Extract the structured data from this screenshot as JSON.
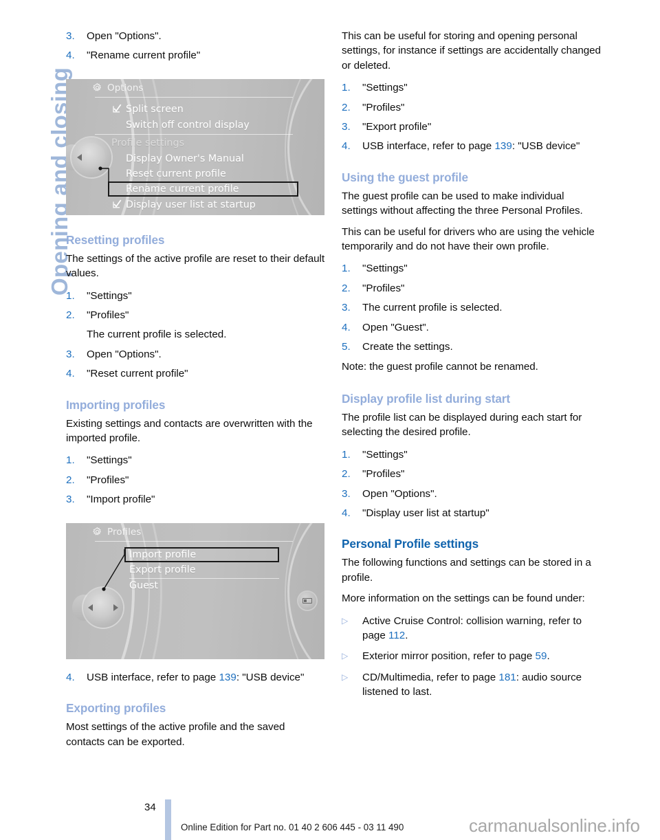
{
  "chapter": {
    "tab_label": "Opening and closing"
  },
  "footer": {
    "page_number": "34",
    "edition_text": "Online Edition for Part no. 01 40 2 606 445 - 03 11 490",
    "watermark": "carmanualsonline.info"
  },
  "colors": {
    "heading_sub": "#93addb",
    "heading_main": "#0f63ad",
    "list_number": "#1d6fbe",
    "page_ref": "#1d6fbe",
    "chapter_tab": "#9fb7da",
    "footer_bar": "#b4c6e2"
  },
  "left_column": {
    "top_steps": [
      {
        "num": "3.",
        "text": "Open \"Options\"."
      },
      {
        "num": "4.",
        "text": "\"Rename current profile\""
      }
    ],
    "figure_options": {
      "name": "idrive-options-screen",
      "header_title": "Options",
      "header_icon": "gear-icon",
      "rows": [
        {
          "label": "Split screen",
          "checkbox": true,
          "dim": false,
          "selected": false
        },
        {
          "label": "Switch off control display",
          "checkbox": false,
          "dim": false,
          "selected": false
        },
        {
          "label": "Profile settings",
          "checkbox": false,
          "dim": true,
          "selected": false
        },
        {
          "label": "Display Owner's Manual",
          "checkbox": false,
          "dim": false,
          "selected": false
        },
        {
          "label": "Reset current profile",
          "checkbox": false,
          "dim": false,
          "selected": false
        },
        {
          "label": "Rename current profile",
          "checkbox": false,
          "dim": false,
          "selected": true
        },
        {
          "label": "Display user list at startup",
          "checkbox": true,
          "dim": false,
          "selected": false
        }
      ]
    },
    "resetting": {
      "heading": "Resetting profiles",
      "intro": "The settings of the active profile are reset to their default values.",
      "steps": [
        {
          "num": "1.",
          "text": "\"Settings\""
        },
        {
          "num": "2.",
          "text": "\"Profiles\""
        },
        {
          "num": "3.",
          "text": "Open \"Options\"."
        },
        {
          "num": "4.",
          "text": "\"Reset current profile\""
        }
      ],
      "substep_note": "The current profile is selected."
    },
    "importing": {
      "heading": "Importing profiles",
      "intro": "Existing settings and contacts are overwritten with the imported profile.",
      "steps": [
        {
          "num": "1.",
          "text": "\"Settings\""
        },
        {
          "num": "2.",
          "text": "\"Profiles\""
        },
        {
          "num": "3.",
          "text": "\"Import profile\""
        }
      ],
      "usb_step": {
        "num": "4.",
        "prefix": "USB interface, refer to page ",
        "page": "139",
        "suffix": ": \"USB device\""
      }
    },
    "figure_profiles": {
      "name": "idrive-profiles-screen",
      "header_title": "Profiles",
      "header_icon": "gear-icon",
      "rows": [
        {
          "label": "Import profile",
          "selected": true
        },
        {
          "label": "Export profile",
          "selected": false
        },
        {
          "label": "Guest",
          "selected": false
        }
      ]
    },
    "exporting": {
      "heading": "Exporting profiles",
      "intro": "Most settings of the active profile and the saved contacts can be exported."
    }
  },
  "right_column": {
    "export_intro": "This can be useful for storing and opening personal settings, for instance if settings are accidentally changed or deleted.",
    "export_steps": [
      {
        "num": "1.",
        "text": "\"Settings\""
      },
      {
        "num": "2.",
        "text": "\"Profiles\""
      },
      {
        "num": "3.",
        "text": "\"Export profile\""
      }
    ],
    "export_usb_step": {
      "num": "4.",
      "prefix": "USB interface, refer to page ",
      "page": "139",
      "suffix": ": \"USB device\""
    },
    "guest": {
      "heading": "Using the guest profile",
      "para1": "The guest profile can be used to make individual settings without affecting the three Personal Profiles.",
      "para2": "This can be useful for drivers who are using the vehicle temporarily and do not have their own profile.",
      "steps": [
        {
          "num": "1.",
          "text": "\"Settings\""
        },
        {
          "num": "2.",
          "text": "\"Profiles\""
        },
        {
          "num": "3.",
          "text": "The current profile is selected."
        },
        {
          "num": "4.",
          "text": "Open \"Guest\"."
        },
        {
          "num": "5.",
          "text": "Create the settings."
        }
      ],
      "note": "Note: the guest profile cannot be renamed."
    },
    "display_list": {
      "heading": "Display profile list during start",
      "intro": "The profile list can be displayed during each start for selecting the desired profile.",
      "steps": [
        {
          "num": "1.",
          "text": "\"Settings\""
        },
        {
          "num": "2.",
          "text": "\"Profiles\""
        },
        {
          "num": "3.",
          "text": "Open \"Options\"."
        },
        {
          "num": "4.",
          "text": "\"Display user list at startup\""
        }
      ]
    },
    "personal": {
      "heading": "Personal Profile settings",
      "para1": "The following functions and settings can be stored in a profile.",
      "para2": "More information on the settings can be found under:",
      "bullets": [
        {
          "marker": "▷",
          "prefix": "Active Cruise Control: collision warning, refer to page ",
          "page": "112",
          "suffix": "."
        },
        {
          "marker": "▷",
          "prefix": "Exterior mirror position, refer to page ",
          "page": "59",
          "suffix": "."
        },
        {
          "marker": "▷",
          "prefix": "CD/Multimedia, refer to page ",
          "page": "181",
          "suffix": ": audio source listened to last."
        }
      ]
    }
  }
}
